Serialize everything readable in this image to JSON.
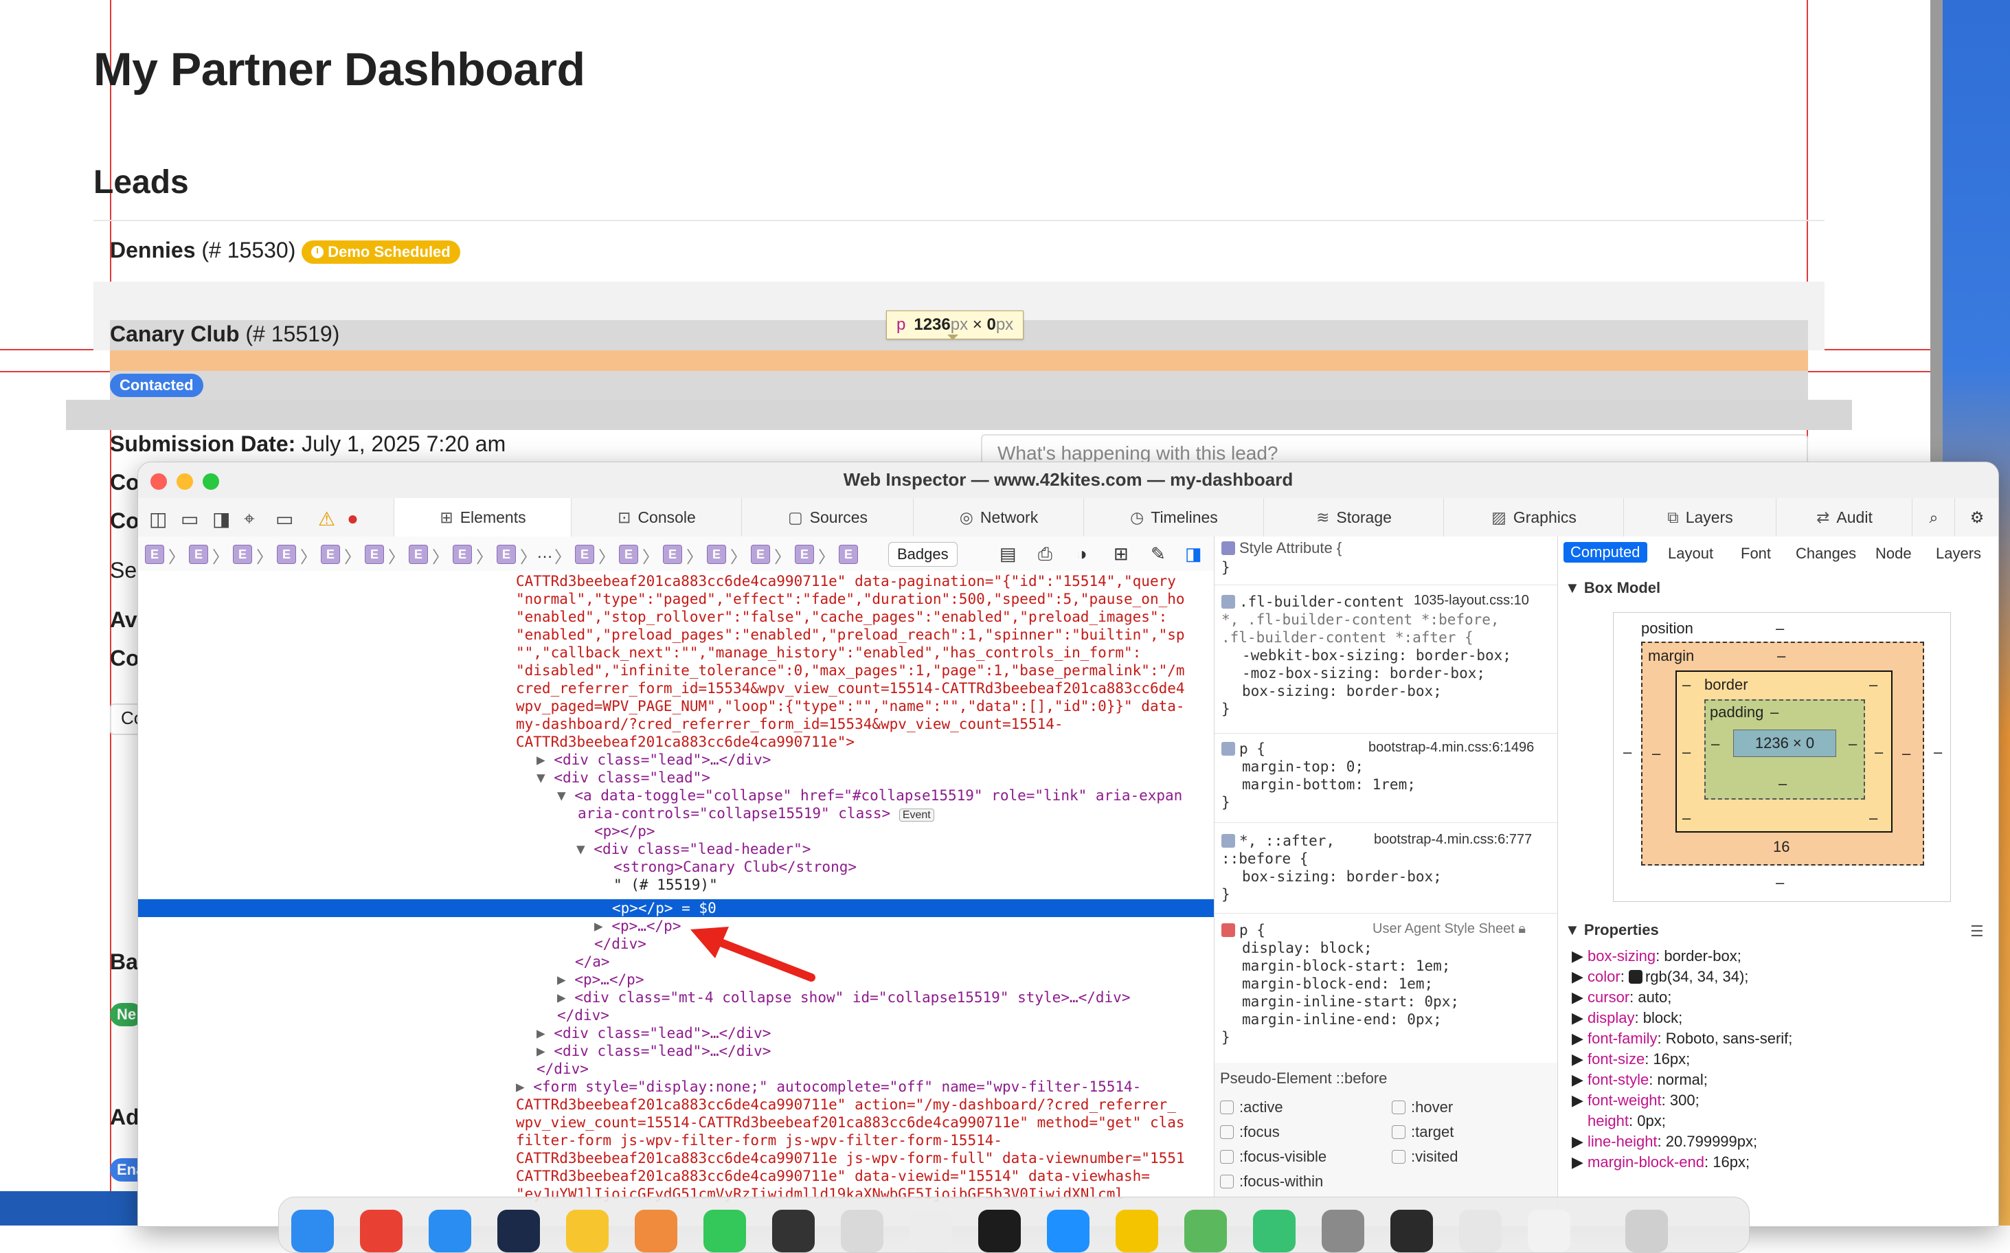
{
  "page": {
    "title": "My Partner Dashboard",
    "leads_heading": "Leads",
    "lead1": {
      "name": "Dennies",
      "id": "(# 15530)",
      "badge": "Demo Scheduled"
    },
    "lead2": {
      "name": "Canary Club",
      "id": "(# 15519)",
      "badge": "Contacted"
    },
    "submission_label": "Submission Date:",
    "submission_value": "July 1, 2025 7:20 am",
    "comment_placeholder": "What's happening with this lead?",
    "cut_labels": [
      "Co",
      "Co",
      "Se",
      "Ava",
      "Co",
      "Ba",
      "Ad"
    ],
    "cut_badges": [
      "Ne",
      "Ena"
    ],
    "cut_box": "Co",
    "size_tooltip": {
      "tag": "p",
      "w": "1236",
      "unit": "px",
      "x": " × ",
      "h": "0"
    }
  },
  "inspector": {
    "title": "Web Inspector — www.42kites.com — my-dashboard",
    "tabs": [
      "Elements",
      "Console",
      "Sources",
      "Network",
      "Timelines",
      "Storage",
      "Graphics",
      "Layers",
      "Audit"
    ],
    "crumb_tag": "E",
    "crumb_ellipsis": "…",
    "badges_label": "Badges",
    "dom_lines": [
      "CATTRd3beebeaf201ca883cc6de4ca990711e\" data-pagination=\"{\"id\":\"15514\",\"query",
      "\"normal\",\"type\":\"paged\",\"effect\":\"fade\",\"duration\":500,\"speed\":5,\"pause_on_ho",
      "\"enabled\",\"stop_rollover\":\"false\",\"cache_pages\":\"enabled\",\"preload_images\":",
      "\"enabled\",\"preload_pages\":\"enabled\",\"preload_reach\":1,\"spinner\":\"builtin\",\"sp",
      "\"\",\"callback_next\":\"\",\"manage_history\":\"enabled\",\"has_controls_in_form\":",
      "\"disabled\",\"infinite_tolerance\":0,\"max_pages\":1,\"page\":1,\"base_permalink\":\"/m",
      "cred_referrer_form_id=15534&wpv_view_count=15514-CATTRd3beebeaf201ca883cc6de4",
      "wpv_paged=WPV_PAGE_NUM\",\"loop\":{\"type\":\"\",\"name\":\"\",\"data\":[],\"id\":0}}\" data-",
      "my-dashboard/?cred_referrer_form_id=15534&wpv_view_count=15514-",
      "CATTRd3beebeaf201ca883cc6de4ca990711e\">"
    ],
    "dom_tree": [
      {
        "indent": 1,
        "tri": "▶",
        "text": "<div class=\"lead\">…</div>"
      },
      {
        "indent": 1,
        "tri": "▼",
        "text": "<div class=\"lead\">"
      },
      {
        "indent": 2,
        "tri": "▼",
        "text": "<a data-toggle=\"collapse\" href=\"#collapse15519\" role=\"link\" aria-expan"
      },
      {
        "indent": 2,
        "tri": "",
        "text": "aria-controls=\"collapse15519\" class>"
      },
      {
        "indent": 3,
        "tri": "",
        "text": "<p></p>"
      },
      {
        "indent": 3,
        "tri": "▼",
        "text": "<div class=\"lead-header\">"
      },
      {
        "indent": 4,
        "tri": "",
        "text": "<strong>Canary Club</strong>"
      },
      {
        "indent": 4,
        "tri": "",
        "text": "\" (# 15519)\""
      }
    ],
    "selected_line": "<p></p> = $0",
    "dom_tree_after": [
      {
        "indent": 4,
        "tri": "▶",
        "text": "<p>…</p>"
      },
      {
        "indent": 3,
        "tri": "",
        "text": "</div>"
      },
      {
        "indent": 2,
        "tri": "",
        "text": "</a>"
      },
      {
        "indent": 2,
        "tri": "▶",
        "text": "<p>…</p>"
      },
      {
        "indent": 2,
        "tri": "▶",
        "text": "<div class=\"mt-4 collapse show\" id=\"collapse15519\" style>…</div>"
      },
      {
        "indent": 1,
        "tri": "",
        "text": "</div>"
      },
      {
        "indent": 1,
        "tri": "▶",
        "text": "<div class=\"lead\">…</div>"
      },
      {
        "indent": 1,
        "tri": "▶",
        "text": "<div class=\"lead\">…</div>"
      },
      {
        "indent": 0,
        "tri": "",
        "text": "</div>"
      },
      {
        "indent": 0,
        "tri": "▶",
        "text": "<form style=\"display:none;\" autocomplete=\"off\" name=\"wpv-filter-15514-"
      },
      {
        "indent": 0,
        "tri": "",
        "text": "CATTRd3beebeaf201ca883cc6de4ca990711e\" action=\"/my-dashboard/?cred_referrer_"
      },
      {
        "indent": 0,
        "tri": "",
        "text": "wpv_view_count=15514-CATTRd3beebeaf201ca883cc6de4ca990711e\" method=\"get\" clas"
      },
      {
        "indent": 0,
        "tri": "",
        "text": "filter-form js-wpv-filter-form js-wpv-filter-form-15514-"
      },
      {
        "indent": 0,
        "tri": "",
        "text": "CATTRd3beebeaf201ca883cc6de4ca990711e js-wpv-form-full\" data-viewnumber=\"1551"
      },
      {
        "indent": 0,
        "tri": "",
        "text": "CATTRd3beebeaf201ca883cc6de4ca990711e\" data-viewid=\"15514\" data-viewhash="
      },
      {
        "indent": 0,
        "tri": "",
        "text": "\"eyJuYW1lIjoicGFydG51cmVyRzIiwidmlld19kaXNwbGF5IjoibGF5b3V0IiwidXNlcml"
      }
    ],
    "event_badge": "Event",
    "styles": {
      "style_attr": "Style Attribute {",
      "rule1_sel": ".fl-builder-content",
      "rule1_src": "1035-layout.css:10",
      "rule1_sel2": "*, .fl-builder-content *:before,",
      "rule1_sel3": ".fl-builder-content *:after {",
      "rule1_p1": "-webkit-box-sizing: border-box;",
      "rule1_p2": "-moz-box-sizing: border-box;",
      "rule1_p3": "box-sizing: border-box;",
      "rule2_sel": "p {",
      "rule2_src": "bootstrap-4.min.css:6:1496",
      "rule2_p1": "margin-top: 0;",
      "rule2_p2": "margin-bottom: 1rem;",
      "rule3_sel": "*, ::after,",
      "rule3_src": "bootstrap-4.min.css:6:777",
      "rule3_sel2": "::before {",
      "rule3_p1": "box-sizing: border-box;",
      "rule4_sel": "p {",
      "rule4_src": "User Agent Style Sheet",
      "rule4_props": [
        "display: block;",
        "margin-block-start: 1em;",
        "margin-block-end: 1em;",
        "margin-inline-start: 0px;",
        "margin-inline-end: 0px;"
      ],
      "close": "}",
      "pseudo_header": "Pseudo-Element ::before",
      "pseudo_states": [
        ":active",
        ":hover",
        ":focus",
        ":target",
        ":focus-visible",
        ":visited",
        ":focus-within"
      ]
    },
    "computed": {
      "tabs": [
        "Computed",
        "Layout",
        "Font",
        "Changes",
        "Node",
        "Layers"
      ],
      "box_model_title": "Box Model",
      "position": "position",
      "margin": "margin",
      "border": "border",
      "padding": "padding",
      "content": "1236 × 0",
      "margin_bottom": "16",
      "dash": "–",
      "properties_title": "Properties",
      "properties": [
        {
          "k": "box-sizing",
          "v": "border-box;"
        },
        {
          "k": "color",
          "v": "rgb(34, 34, 34);"
        },
        {
          "k": "cursor",
          "v": "auto;"
        },
        {
          "k": "display",
          "v": "block;"
        },
        {
          "k": "font-family",
          "v": "Roboto, sans-serif;"
        },
        {
          "k": "font-size",
          "v": "16px;"
        },
        {
          "k": "font-style",
          "v": "normal;"
        },
        {
          "k": "font-weight",
          "v": "300;"
        },
        {
          "k": "height",
          "v": "0px;"
        },
        {
          "k": "line-height",
          "v": "20.799999px;"
        },
        {
          "k": "margin-block-end",
          "v": "16px;"
        }
      ]
    }
  },
  "colors": {
    "accent": "#0a5fd6",
    "badge_yellow": "#f2b705",
    "badge_blue": "#3b7de8",
    "highlight_orange": "#f7c08a"
  }
}
